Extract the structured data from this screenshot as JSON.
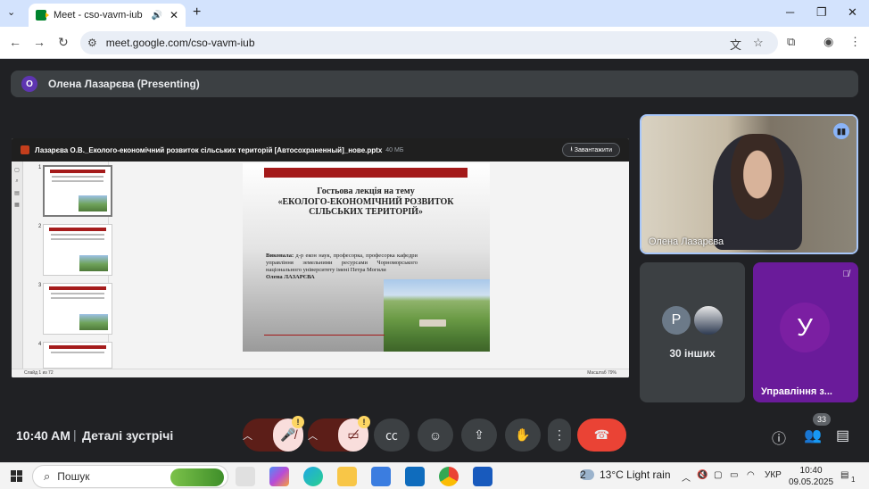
{
  "browser": {
    "tab_title": "Meet - cso-vavm-iub",
    "url": "meet.google.com/cso-vavm-iub",
    "new_tab": "+",
    "tabs_menu": "⌄",
    "back": "←",
    "forward": "→",
    "reload": "↻",
    "minimize": "─",
    "maximize": "❐",
    "close": "✕"
  },
  "presenter_bar": {
    "avatar_letter": "О",
    "label": "Олена Лазарєва (Presenting)"
  },
  "shared": {
    "file_name": "Лазарєва О.В._Еколого-економічний розвиток сільських територій [Автосохраненный]_нове.pptx",
    "file_size": "40 МБ",
    "download": "Завантажити",
    "slide_title_1": "Гостьова лекція на тему",
    "slide_title_2": "«ЕКОЛОГО-ЕКОНОМІЧНИЙ РОЗВИТОК СІЛЬСЬКИХ ТЕРИТОРІЙ»",
    "slide_body_label": "Виконала:",
    "slide_body": " д-р екон наук, професорка, професорка кафедри управління земельними ресурсами Чорноморського національного університету імені Петра Могили",
    "slide_author": "Олена ЛАЗАРЄВА",
    "thumb_numbers": [
      "1",
      "2",
      "3",
      "4"
    ],
    "status_left": "Слайд 1 из 72",
    "status_zoom": "Масштаб 79%"
  },
  "tiles": {
    "speaker_name": "Олена Лазарєва",
    "others_avatar": "P",
    "others_label": "30 інших",
    "room_avatar": "У",
    "room_label": "Управління з..."
  },
  "bottom": {
    "time": "10:40 AM",
    "separator": "|",
    "details": "Деталі зустрічі",
    "warning": "!",
    "participants_count": "33"
  },
  "taskbar": {
    "search_placeholder": "Пошук",
    "weather": "13°C  Light rain",
    "weather_badge": "2",
    "lang": "УКР",
    "clock_time": "10:40",
    "clock_date": "09.05.2025",
    "notif": "1"
  },
  "colors": {
    "meet_bg": "#202124",
    "end_call": "#ea4335",
    "mic_off_bg": "#f9dedc",
    "tile_purple": "#6a1b9a",
    "active_speaker_border": "#a8c7fa"
  }
}
